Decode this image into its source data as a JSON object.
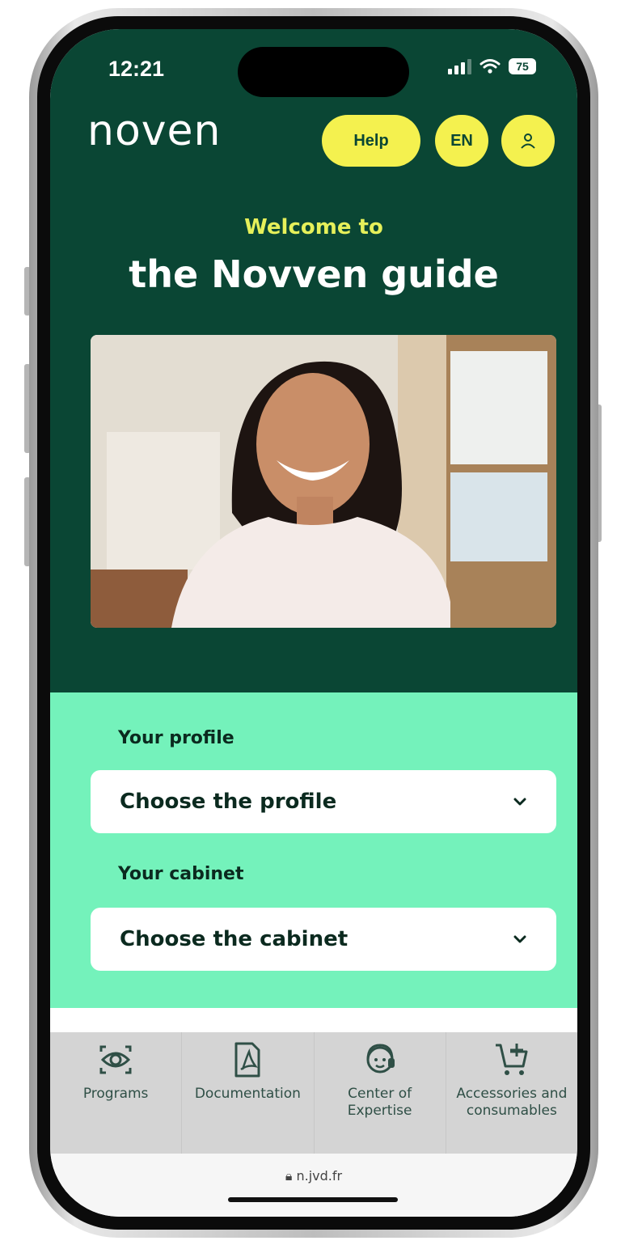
{
  "status_bar": {
    "time": "12:21",
    "battery": "75"
  },
  "header": {
    "logo_text": "noven",
    "help_label": "Help",
    "language_label": "EN"
  },
  "hero": {
    "welcome": "Welcome to",
    "title": "the Novven guide"
  },
  "form": {
    "profile_label": "Your profile",
    "profile_select": "Choose the profile",
    "cabinet_label": "Your cabinet",
    "cabinet_select": "Choose the cabinet"
  },
  "nav": {
    "items": [
      {
        "label": "Programs",
        "icon": "eye-icon"
      },
      {
        "label": "Documentation",
        "icon": "pdf-document-icon"
      },
      {
        "label": "Center of Expertise",
        "icon": "support-agent-icon"
      },
      {
        "label": "Accessories and consumables",
        "icon": "cart-add-icon"
      }
    ]
  },
  "browser": {
    "url": "n.jvd.fr"
  },
  "colors": {
    "hero_background": "#0a4634",
    "accent_yellow": "#f4f14f",
    "form_background": "#74f2bb",
    "nav_background": "#d4d4d4"
  }
}
